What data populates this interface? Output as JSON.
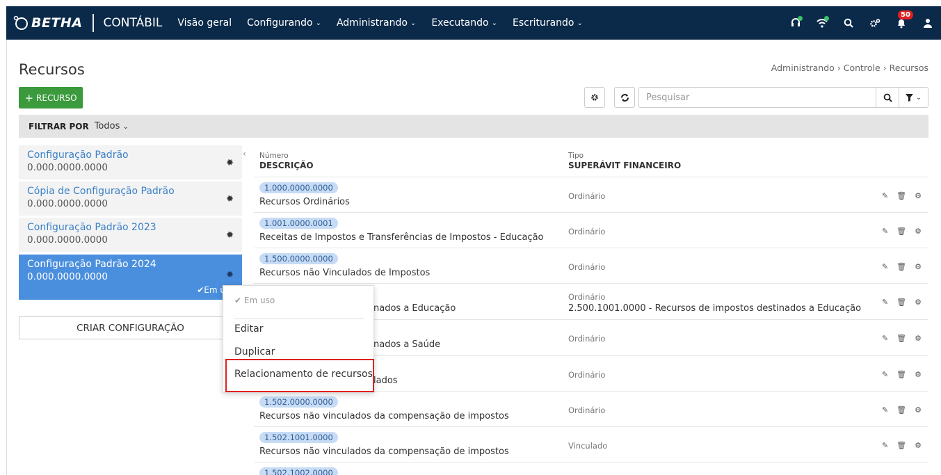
{
  "header": {
    "brand": "BETHA",
    "module": "CONTÁBIL",
    "nav": [
      {
        "label": "Visão geral",
        "has_dropdown": false
      },
      {
        "label": "Configurando",
        "has_dropdown": true
      },
      {
        "label": "Administrando",
        "has_dropdown": true
      },
      {
        "label": "Executando",
        "has_dropdown": true
      },
      {
        "label": "Escriturando",
        "has_dropdown": true
      }
    ],
    "notification_count": "50"
  },
  "page": {
    "title": "Recursos",
    "breadcrumb": "Administrando › Controle › Recursos",
    "add_button": "RECURSO",
    "search_placeholder": "Pesquisar"
  },
  "filter": {
    "label": "FILTRAR POR",
    "value": "Todos"
  },
  "configs": [
    {
      "name": "Configuração Padrão",
      "number": "0.000.0000.0000"
    },
    {
      "name": "Cópia de Configuração Padrão",
      "number": "0.000.0000.0000"
    },
    {
      "name": "Configuração Padrão 2023",
      "number": "0.000.0000.0000"
    },
    {
      "name": "Configuração Padrão 2024",
      "number": "0.000.0000.0000",
      "status": "Em u"
    }
  ],
  "create_config_button": "CRIAR CONFIGURAÇÃO",
  "table": {
    "col1_small": "Número",
    "col1_big": "DESCRIÇÃO",
    "col2_small": "Tipo",
    "col2_big": "SUPERÁVIT FINANCEIRO",
    "rows": [
      {
        "code": "1.000.0000.0000",
        "desc": "Recursos Ordinários",
        "tipo": "Ordinário"
      },
      {
        "code": "1.001.0000.0001",
        "desc": "Receitas de Impostos e Transferências de Impostos - Educação",
        "tipo": "Ordinário"
      },
      {
        "code": "1.500.0000.0000",
        "desc": "Recursos não Vinculados de Impostos",
        "tipo": "Ordinário"
      },
      {
        "code": "",
        "desc": "nados a Educação",
        "tipo": "Ordinário",
        "superavit": "2.500.1001.0000 - Recursos de impostos destinados a Educação"
      },
      {
        "code": "",
        "desc": "nados a Saúde",
        "tipo": "Ordinário"
      },
      {
        "code": "",
        "desc": "lados",
        "tipo": "Ordinário"
      },
      {
        "code": "1.502.0000.0000",
        "desc": "Recursos não vinculados da compensação de impostos",
        "tipo": "Ordinário"
      },
      {
        "code": "1.502.1001.0000",
        "desc": "Recursos não vinculados da compensação de impostos",
        "tipo": "Vinculado"
      },
      {
        "code": "1.502.1002.0000",
        "desc": "",
        "tipo": ""
      }
    ]
  },
  "context_menu": {
    "in_use": "Em uso",
    "edit": "Editar",
    "duplicate": "Duplicar",
    "relationship": "Relacionamento de recursos"
  },
  "colors": {
    "topbar": "#0b2a4a",
    "accent": "#4a8fde",
    "add_button": "#3a9a3c",
    "highlight": "#e02020"
  }
}
